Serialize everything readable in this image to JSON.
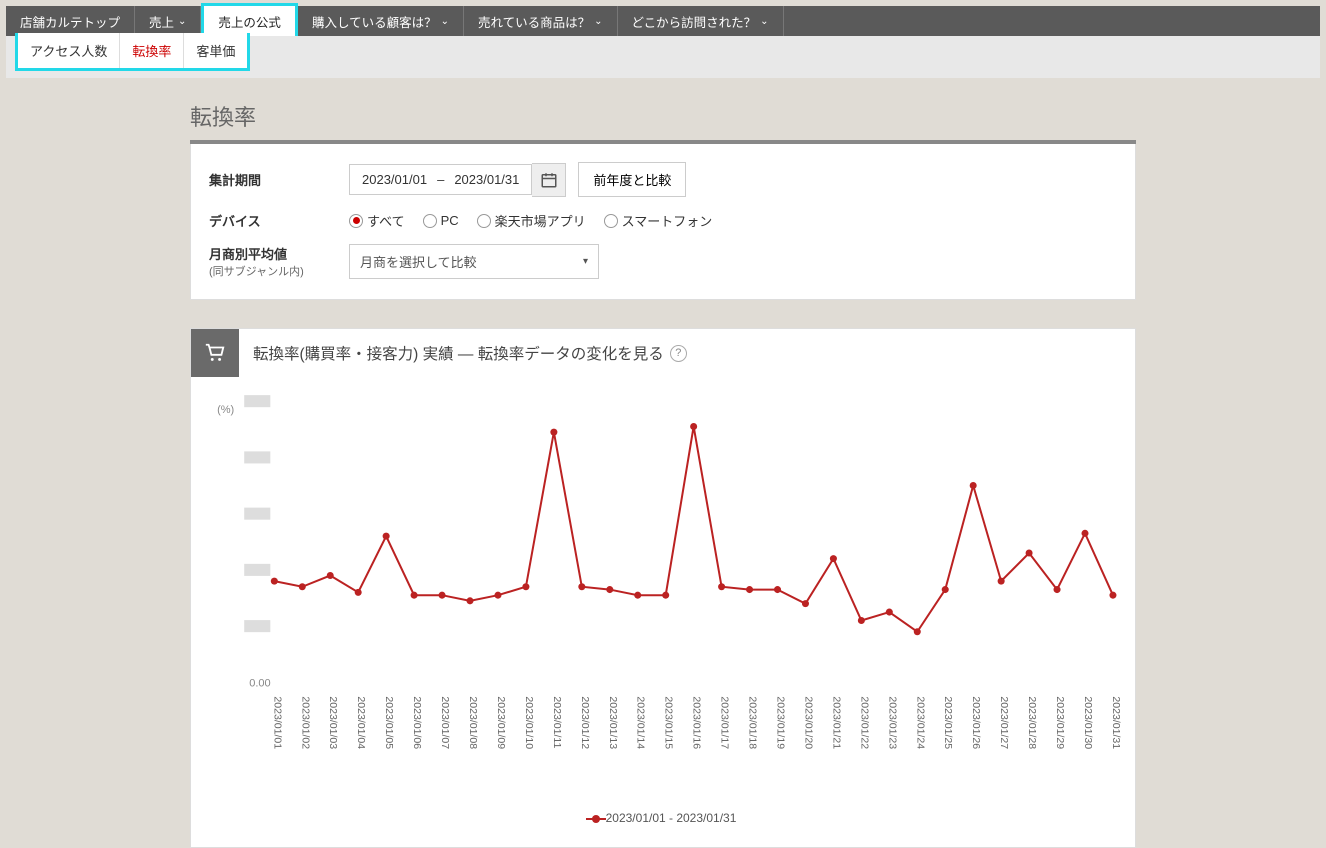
{
  "topnav": {
    "items": [
      {
        "label": "店舗カルテトップ",
        "chevron": false
      },
      {
        "label": "売上",
        "chevron": true
      },
      {
        "label": "売上の公式",
        "chevron": false,
        "active": true
      },
      {
        "label": "購入している顧客は？",
        "chevron": true
      },
      {
        "label": "売れている商品は？",
        "chevron": true
      },
      {
        "label": "どこから訪問された？",
        "chevron": true
      }
    ]
  },
  "subtabs": {
    "items": [
      {
        "label": "アクセス人数"
      },
      {
        "label": "転換率",
        "active": true
      },
      {
        "label": "客単価"
      }
    ]
  },
  "page": {
    "title": "転換率"
  },
  "filters": {
    "period_label": "集計期間",
    "date_start": "2023/01/01",
    "date_sep": "–",
    "date_end": "2023/01/31",
    "compare_button": "前年度と比較",
    "device_label": "デバイス",
    "device_options": [
      "すべて",
      "PC",
      "楽天市場アプリ",
      "スマートフォン"
    ],
    "device_selected": 0,
    "avg_label": "月商別平均値",
    "avg_sub": "(同サブジャンル内)",
    "avg_select_placeholder": "月商を選択して比較"
  },
  "chart_head": {
    "title": "転換率(購買率・接客力) 実績 ― 転換率データの変化を見る"
  },
  "legend": {
    "label": "2023/01/01 - 2023/01/31"
  },
  "chart_data": {
    "type": "line",
    "ylabel": "(%)",
    "ylim": [
      0,
      5
    ],
    "zero_label": "0.00",
    "y_ticks_redacted": [
      1,
      2,
      3,
      4,
      5
    ],
    "categories": [
      "2023/01/01",
      "2023/01/02",
      "2023/01/03",
      "2023/01/04",
      "2023/01/05",
      "2023/01/06",
      "2023/01/07",
      "2023/01/08",
      "2023/01/09",
      "2023/01/10",
      "2023/01/11",
      "2023/01/12",
      "2023/01/13",
      "2023/01/14",
      "2023/01/15",
      "2023/01/16",
      "2023/01/17",
      "2023/01/18",
      "2023/01/19",
      "2023/01/20",
      "2023/01/21",
      "2023/01/22",
      "2023/01/23",
      "2023/01/24",
      "2023/01/25",
      "2023/01/26",
      "2023/01/27",
      "2023/01/28",
      "2023/01/29",
      "2023/01/30",
      "2023/01/31"
    ],
    "series": [
      {
        "name": "2023/01/01 - 2023/01/31",
        "values": [
          1.8,
          1.7,
          1.9,
          1.6,
          2.6,
          1.55,
          1.55,
          1.45,
          1.55,
          1.7,
          4.45,
          1.7,
          1.65,
          1.55,
          1.55,
          4.55,
          1.7,
          1.65,
          1.65,
          1.4,
          2.2,
          1.1,
          1.25,
          0.9,
          1.65,
          3.5,
          1.8,
          2.3,
          1.65,
          2.65,
          1.55
        ]
      }
    ]
  }
}
